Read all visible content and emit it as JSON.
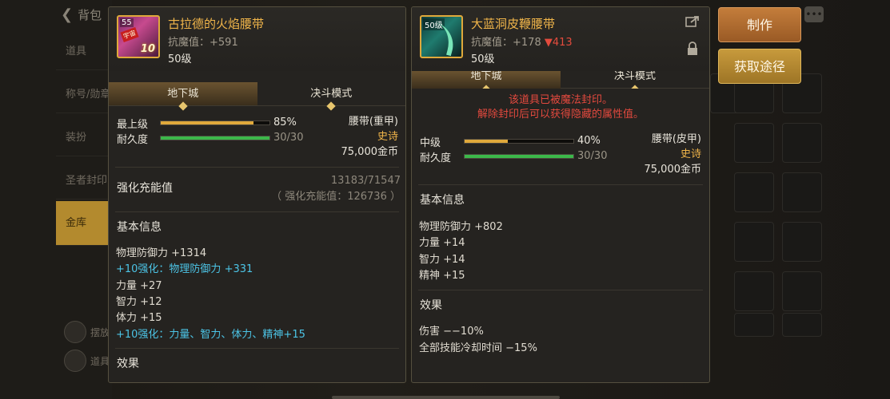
{
  "background": {
    "back_title": "背包",
    "menu": [
      "道具",
      "称号/勋章",
      "装扮",
      "圣者封印",
      "金库"
    ],
    "active_menu_index": 4,
    "bottom_items": [
      "摆放",
      "道具"
    ]
  },
  "left_item": {
    "icon_level_tag": "55",
    "icon_badge": "宇宙",
    "icon_number": "10",
    "name": "古拉德的火焰腰带",
    "magic_resist_label": "抗魔值：",
    "magic_resist_value": "+591",
    "level": "50级",
    "tabs": [
      "地下城",
      "决斗模式"
    ],
    "active_tab": 0,
    "grade_label": "最上级",
    "grade_pct": "85%",
    "grade_fill": 0.85,
    "durability_label": "耐久度",
    "durability_value": "30/30",
    "durability_fill": 1.0,
    "type": "腰带(重甲)",
    "rarity": "史诗",
    "price": "75,000金币",
    "enhance_label": "强化充能值",
    "enhance_value": "13183/71547",
    "enhance_total": "（ 强化充能值：126736 ）",
    "basic_info_title": "基本信息",
    "stats": [
      {
        "text": "物理防御力 +1314",
        "cyan": false
      },
      {
        "text": "+10强化：物理防御力 +331",
        "cyan": true
      },
      {
        "text": "力量 +27",
        "cyan": false
      },
      {
        "text": "智力 +12",
        "cyan": false
      },
      {
        "text": "体力 +15",
        "cyan": false
      },
      {
        "text": "+10强化：力量、智力、体力、精神+15",
        "cyan": true
      }
    ],
    "effects_title": "效果"
  },
  "right_item": {
    "icon_level_tag": "50级",
    "name": "大蓝洞皮鞭腰带",
    "magic_resist_label": "抗魔值：",
    "magic_resist_value": "+178",
    "magic_resist_diff": "▼413",
    "level": "50级",
    "tabs": [
      "地下城",
      "决斗模式"
    ],
    "active_tab": 0,
    "seal_line1": "该道具已被魔法封印。",
    "seal_line2": "解除封印后可以获得隐藏的属性值。",
    "grade_label": "中级",
    "grade_pct": "40%",
    "grade_fill": 0.4,
    "durability_label": "耐久度",
    "durability_value": "30/30",
    "durability_fill": 1.0,
    "type": "腰带(皮甲)",
    "rarity": "史诗",
    "price": "75,000金币",
    "basic_info_title": "基本信息",
    "stats": [
      "物理防御力 +802",
      "力量 +14",
      "智力 +14",
      "精神 +15"
    ],
    "effects_title": "效果",
    "effects": [
      "伤害 −−10%",
      "全部技能冷却时间 −15%"
    ]
  },
  "buttons": {
    "make": "制作",
    "get": "获取途径"
  },
  "icons": {
    "share": "share-icon",
    "lock": "lock-icon",
    "chat": "chat-icon",
    "back": "back-arrow-icon"
  },
  "colors": {
    "gold_text": "#f0b54a",
    "cyan_text": "#4cc4e6",
    "red_text": "#e3493e",
    "grade_bar": "#e0a93b",
    "durability_bar": "#3cb84a"
  }
}
